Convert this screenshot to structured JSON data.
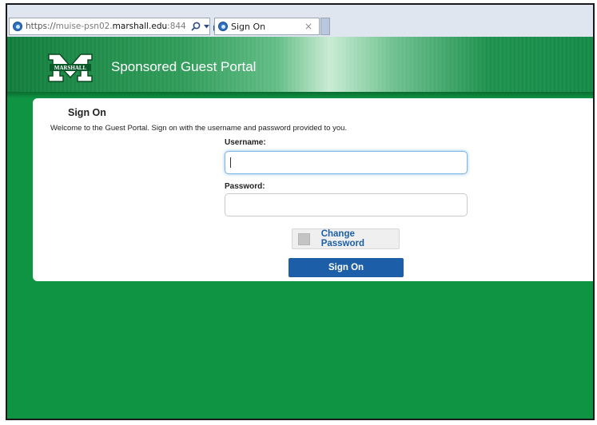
{
  "browser": {
    "url_protocol": "https://",
    "url_subdomain": "muise-psn02.",
    "url_host": "marshall.edu",
    "url_port": ":844",
    "tab_title": "Sign On",
    "tab_close": "×"
  },
  "header": {
    "logo_text": "MARSHALL",
    "title": "Sponsored Guest Portal"
  },
  "form": {
    "heading": "Sign On",
    "welcome": "Welcome to the Guest Portal. Sign on with the username and password provided to you.",
    "username_label": "Username:",
    "username_value": "",
    "password_label": "Password:",
    "password_value": "",
    "change_password_label": "Change Password",
    "sign_on_label": "Sign On"
  },
  "colors": {
    "brand_green": "#0f9444",
    "button_blue": "#1c5fa8",
    "link_blue": "#1d5fa6"
  }
}
